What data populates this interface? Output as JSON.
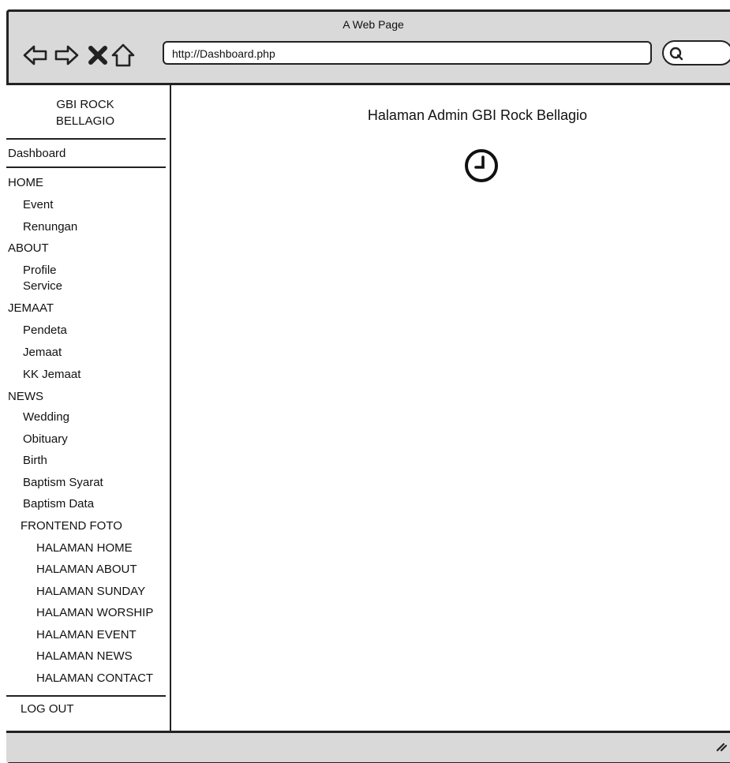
{
  "window": {
    "title": "A Web Page"
  },
  "toolbar": {
    "back_icon": "back-arrow-icon",
    "forward_icon": "forward-arrow-icon",
    "stop_icon": "close-icon",
    "home_icon": "home-icon",
    "address": "http://Dashboard.php",
    "search_icon": "search-icon"
  },
  "sidebar": {
    "brand_line1": "GBI ROCK",
    "brand_line2": "BELLAGIO",
    "dashboard": "Dashboard",
    "items": [
      {
        "label": "HOME",
        "level": 0
      },
      {
        "label": "Event",
        "level": 1
      },
      {
        "label": "Renungan",
        "level": 1
      },
      {
        "label": "ABOUT",
        "level": 0
      },
      {
        "label": "Profile",
        "level": 1
      },
      {
        "label": "Service",
        "level": 1
      },
      {
        "label": "JEMAAT",
        "level": 0
      },
      {
        "label": "Pendeta",
        "level": 1
      },
      {
        "label": "Jemaat",
        "level": 1
      },
      {
        "label": "KK Jemaat",
        "level": 1
      },
      {
        "label": "NEWS",
        "level": 0
      },
      {
        "label": "Wedding",
        "level": 1
      },
      {
        "label": "Obituary",
        "level": 1
      },
      {
        "label": "Birth",
        "level": 1
      },
      {
        "label": "Baptism Syarat",
        "level": 1
      },
      {
        "label": "Baptism Data",
        "level": 1
      },
      {
        "label": "FRONTEND FOTO",
        "level": 1
      },
      {
        "label": "HALAMAN  HOME",
        "level": 2
      },
      {
        "label": "HALAMAN ABOUT",
        "level": 2
      },
      {
        "label": "HALAMAN SUNDAY",
        "level": 2
      },
      {
        "label": "HALAMAN WORSHIP",
        "level": 2
      },
      {
        "label": "HALAMAN EVENT",
        "level": 2
      },
      {
        "label": "HALAMAN NEWS",
        "level": 2
      },
      {
        "label": "HALAMAN CONTACT",
        "level": 2
      }
    ],
    "logout": "LOG OUT"
  },
  "main": {
    "title": "Halaman Admin GBI Rock Bellagio",
    "icon": "clock-icon"
  }
}
